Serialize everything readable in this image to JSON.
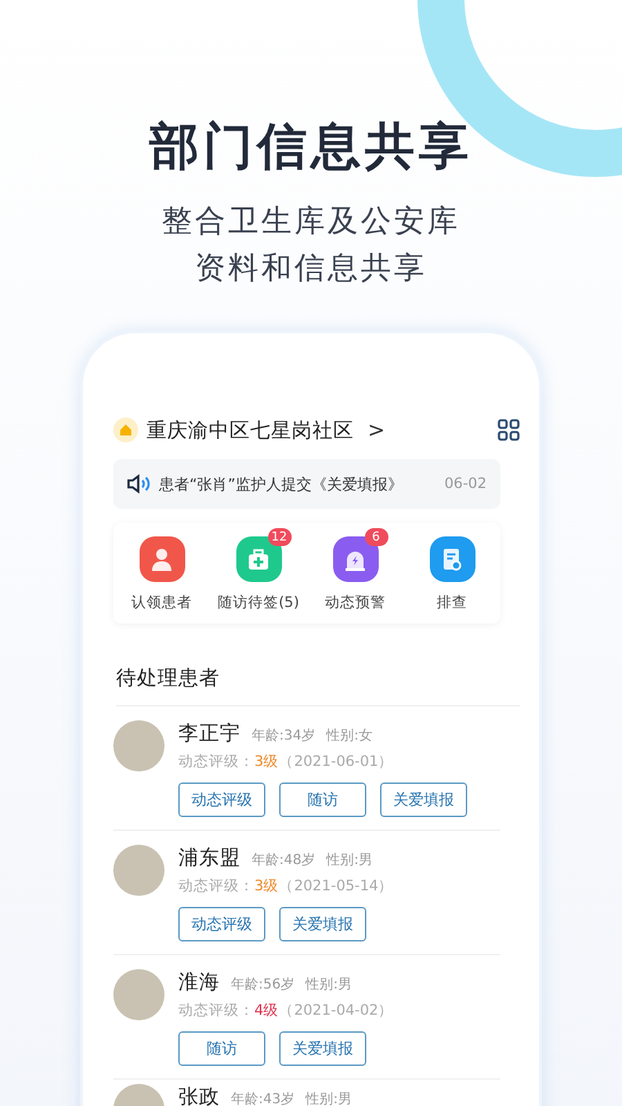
{
  "headline": "部门信息共享",
  "subtitle_lines": [
    "整合卫生库及公安库",
    "资料和信息共享"
  ],
  "community": {
    "name": "重庆渝中区七星岗社区",
    "chevron": ">"
  },
  "notice": {
    "text": "患者“张肖”监护人提交《关爱填报》",
    "date": "06-02"
  },
  "shortcuts": [
    {
      "kind": "claim",
      "label": "认领患者",
      "color": "#f0574a"
    },
    {
      "kind": "kit",
      "label": "随访待签(5)",
      "badge": "12",
      "color": "#1fc98e"
    },
    {
      "kind": "alarm",
      "label": "动态预警",
      "badge": "6",
      "color": "#8b5cf0"
    },
    {
      "kind": "doc",
      "label": "排查",
      "color": "#1f9bf0"
    }
  ],
  "section_title": "待处理患者",
  "patients": [
    {
      "name": "李正宇",
      "age": "年龄:34岁",
      "gender": "性别:女",
      "grade_label": "动态评级：",
      "grade": "3级",
      "color": "#f08a2c",
      "date": "（2021-06-01）",
      "actions": [
        "动态评级",
        "随访",
        "关爱填报"
      ]
    },
    {
      "name": "浦东盟",
      "age": "年龄:48岁",
      "gender": "性别:男",
      "grade_label": "动态评级：",
      "grade": "3级",
      "color": "#f08a2c",
      "date": "（2021-05-14）",
      "actions": [
        "动态评级",
        "关爱填报"
      ]
    },
    {
      "name": "淮海",
      "age": "年龄:56岁",
      "gender": "性别:男",
      "grade_label": "动态评级：",
      "grade": "4级",
      "color": "#e0334f",
      "date": "（2021-04-02）",
      "actions": [
        "随访",
        "关爱填报"
      ]
    },
    {
      "name": "张政",
      "age": "年龄:43岁",
      "gender": "性别:男"
    }
  ]
}
